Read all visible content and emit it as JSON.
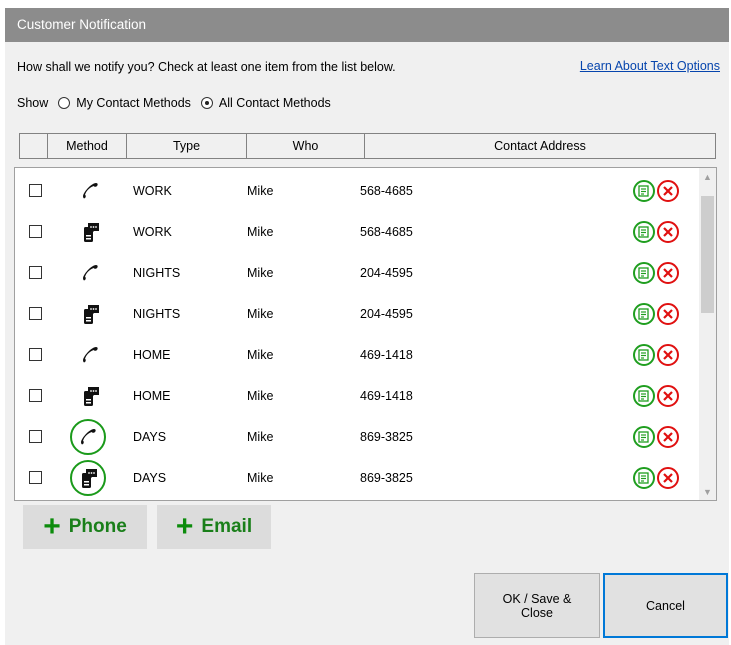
{
  "window": {
    "title": "Customer Notification"
  },
  "prompt": "How shall we notify you?  Check at least one item from the list below.",
  "learn_link": "Learn About Text Options",
  "show": {
    "label": "Show",
    "options": [
      "My Contact Methods",
      "All Contact Methods"
    ],
    "selected": "All Contact Methods"
  },
  "columns": [
    "Method",
    "Type",
    "Who",
    "Contact Address"
  ],
  "rows": [
    {
      "method": "phone-icon",
      "type": "WORK",
      "who": "Mike",
      "address": "568-4685",
      "highlighted": false
    },
    {
      "method": "text-message-icon",
      "type": "WORK",
      "who": "Mike",
      "address": "568-4685",
      "highlighted": false
    },
    {
      "method": "phone-icon",
      "type": "NIGHTS",
      "who": "Mike",
      "address": "204-4595",
      "highlighted": false
    },
    {
      "method": "text-message-icon",
      "type": "NIGHTS",
      "who": "Mike",
      "address": "204-4595",
      "highlighted": false
    },
    {
      "method": "phone-icon",
      "type": "HOME",
      "who": "Mike",
      "address": "469-1418",
      "highlighted": false
    },
    {
      "method": "text-message-icon",
      "type": "HOME",
      "who": "Mike",
      "address": "469-1418",
      "highlighted": false
    },
    {
      "method": "phone-icon",
      "type": "DAYS",
      "who": "Mike",
      "address": "869-3825",
      "highlighted": true
    },
    {
      "method": "text-message-icon",
      "type": "DAYS",
      "who": "Mike",
      "address": "869-3825",
      "highlighted": true
    }
  ],
  "buttons": {
    "add_phone": "Phone",
    "add_email": "Email",
    "ok": "OK / Save & Close",
    "cancel": "Cancel"
  },
  "colors": {
    "titlebar": "#8c8c8c",
    "accent_green": "#1a9a1a",
    "delete_red": "#e01010",
    "link_blue": "#0645ad",
    "focus_blue": "#0078d7"
  }
}
